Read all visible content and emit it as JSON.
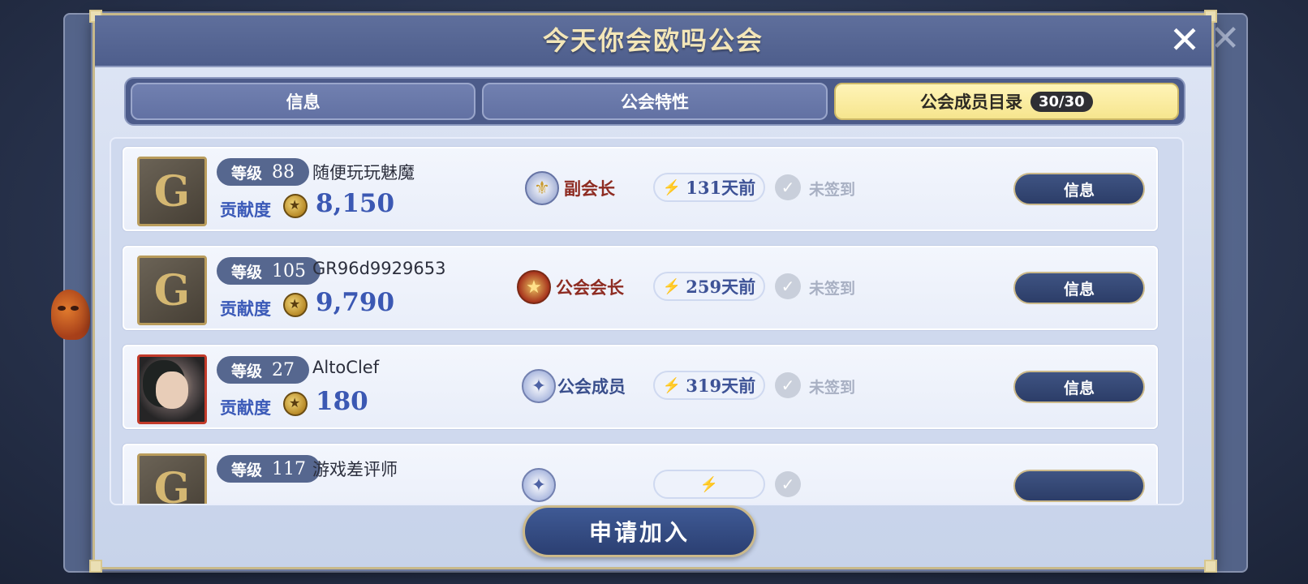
{
  "dialog": {
    "title": "今天你会欧吗公会",
    "close_icon": "✕"
  },
  "tabs": [
    {
      "label": "信息",
      "active": false
    },
    {
      "label": "公会特性",
      "active": false
    },
    {
      "label": "公会成员目录",
      "active": true,
      "count": "30/30"
    }
  ],
  "level_label": "等级",
  "contribution_label": "贡献度",
  "members": [
    {
      "level": "88",
      "name": "随便玩玩魅魔",
      "contribution": "8,150",
      "role": "副会长",
      "last_login": "131天前",
      "checkin": "未签到",
      "info_label": "信息",
      "avatar": "guild-G"
    },
    {
      "level": "105",
      "name": "GR96d9929653",
      "contribution": "9,790",
      "role": "公会会长",
      "last_login": "259天前",
      "checkin": "未签到",
      "info_label": "信息",
      "avatar": "guild-G"
    },
    {
      "level": "27",
      "name": "AltoClef",
      "contribution": "180",
      "role": "公会成员",
      "last_login": "319天前",
      "checkin": "未签到",
      "info_label": "信息",
      "avatar": "character-portrait"
    },
    {
      "level": "117",
      "name": "游戏差评师",
      "contribution": "",
      "role": "",
      "last_login": "",
      "checkin": "",
      "info_label": "",
      "avatar": "guild-G"
    }
  ],
  "apply_button": "申请加入",
  "colors": {
    "accent_gold": "#f3e6b8",
    "header": "#4e5e8c",
    "active_tab": "#f6e58e",
    "button_navy": "#2c3d68"
  }
}
